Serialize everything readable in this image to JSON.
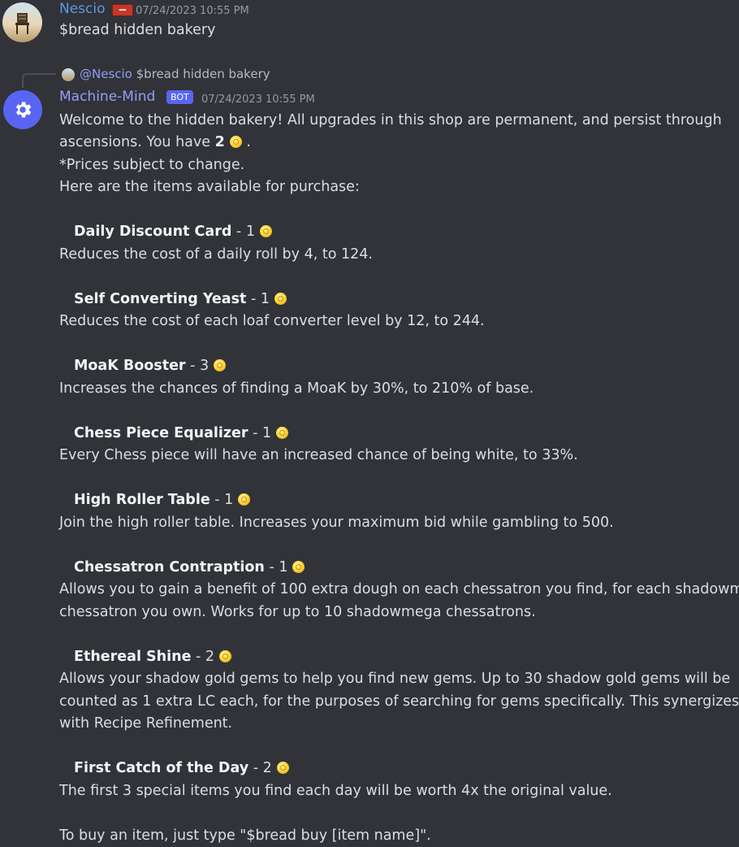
{
  "messages": [
    {
      "author": "Nescio",
      "timestamp": "07/24/2023 10:55 PM",
      "text": "$bread hidden bakery",
      "avatar_icon": "chair-on-beach-avatar",
      "author_color": "#5d98e6"
    },
    {
      "author": "Machine-Mind",
      "badge": "BOT",
      "timestamp": "07/24/2023 10:55 PM",
      "avatar_icon": "gear-icon",
      "author_color": "#949cf7",
      "reply": {
        "mention": "@Nescio",
        "text": "$bread hidden bakery"
      },
      "intro": {
        "line1": "Welcome to the hidden bakery! All upgrades in this shop are permanent, and persist through",
        "line2_prefix": "ascensions. You have ",
        "line2_amount": "2",
        "line2_suffix": ".",
        "line3": "*Prices subject to change.",
        "line4": "Here are the items available for purchase:"
      },
      "items": [
        {
          "name": "Daily Discount Card",
          "price": "1",
          "desc": [
            "Reduces the cost of a daily roll by 4, to 124."
          ]
        },
        {
          "name": "Self Converting Yeast",
          "price": "1",
          "desc": [
            "Reduces the cost of each loaf converter level by 12, to 244."
          ]
        },
        {
          "name": "MoaK Booster",
          "price": "3",
          "desc": [
            "Increases the chances of finding a MoaK by 30%, to 210% of base."
          ]
        },
        {
          "name": "Chess Piece Equalizer",
          "price": "1",
          "desc": [
            "Every Chess piece will have an increased chance of being white, to 33%."
          ]
        },
        {
          "name": "High Roller Table",
          "price": "1",
          "desc": [
            "Join the high roller table. Increases your maximum bid while gambling to 500."
          ]
        },
        {
          "name": "Chessatron Contraption",
          "price": "1",
          "desc": [
            "Allows you to gain a benefit of 100 extra dough on each chessatron you find, for each shadowmega",
            "chessatron you own. Works for up to 10 shadowmega chessatrons."
          ]
        },
        {
          "name": "Ethereal Shine",
          "price": "2",
          "desc": [
            "Allows your shadow gold gems to help you find new gems. Up to 30 shadow gold gems will be",
            "counted as 1 extra LC each, for the purposes of searching for gems specifically. This synergizes",
            "with Recipe Refinement."
          ]
        },
        {
          "name": "First Catch of the Day",
          "price": "2",
          "desc": [
            "The first 3 special items you find each day will be worth 4x the original value."
          ]
        }
      ],
      "footer": "To buy an item, just type \"$bread buy [item name]\"."
    }
  ],
  "theme": {
    "background": "#313338",
    "text": "#dbdee1",
    "muted": "#949ba4",
    "bot_badge": "#5865f2",
    "coin": "#ffd83d"
  }
}
